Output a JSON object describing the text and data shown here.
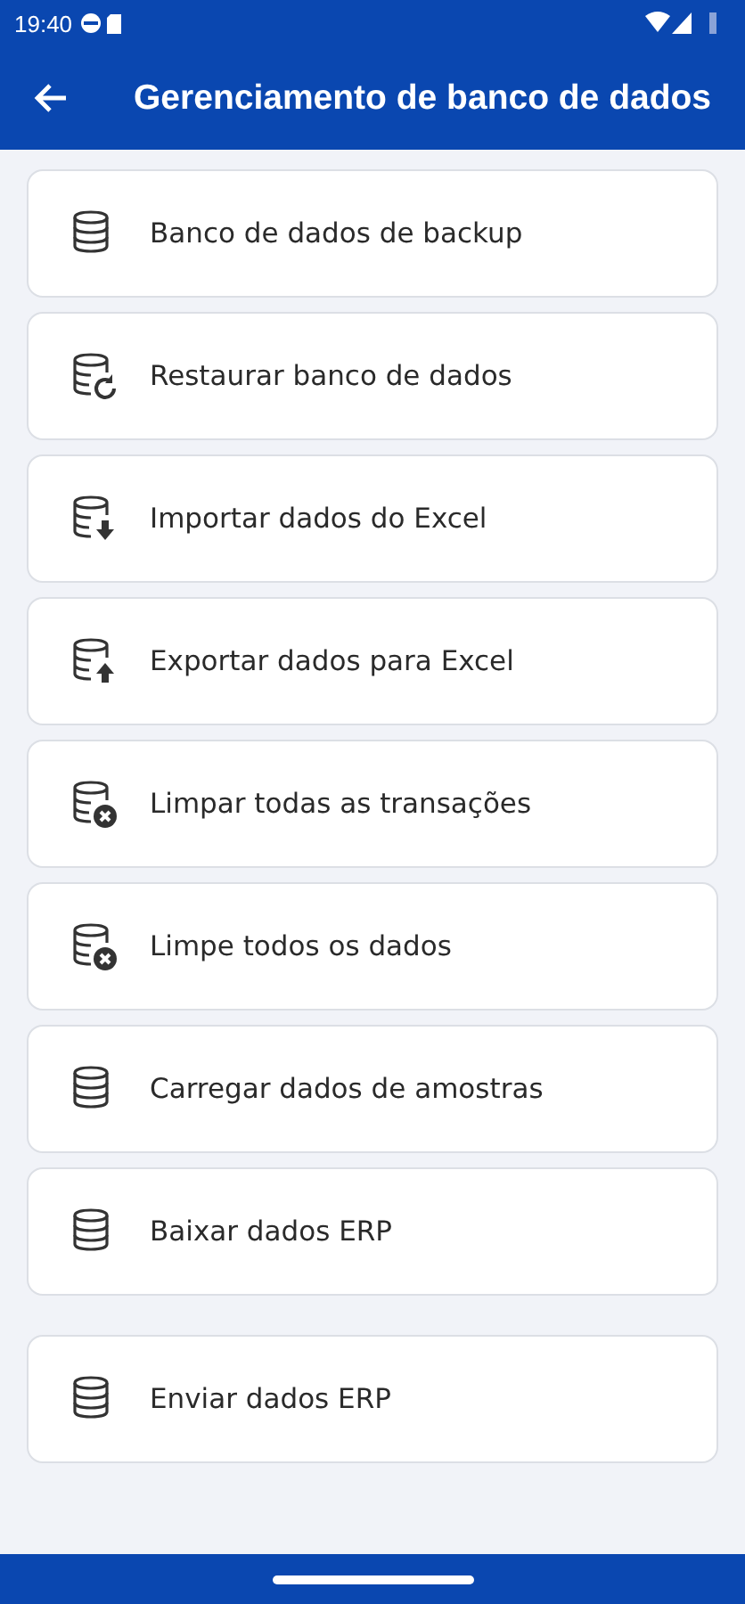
{
  "status_bar": {
    "time": "19:40"
  },
  "app_bar": {
    "title": "Gerenciamento de banco de dados"
  },
  "groups": [
    {
      "items": [
        {
          "label": "Banco de dados de backup",
          "kind": "plain"
        },
        {
          "label": "Restaurar banco de dados",
          "kind": "restore"
        },
        {
          "label": "Importar dados do Excel",
          "kind": "import"
        },
        {
          "label": "Exportar dados para Excel",
          "kind": "export"
        },
        {
          "label": "Limpar todas as transações",
          "kind": "clear"
        },
        {
          "label": "Limpe todos os dados",
          "kind": "clear"
        },
        {
          "label": "Carregar dados de amostras",
          "kind": "plain"
        },
        {
          "label": "Baixar dados ERP",
          "kind": "plain"
        }
      ]
    },
    {
      "items": [
        {
          "label": "Enviar dados ERP",
          "kind": "plain"
        }
      ]
    }
  ]
}
